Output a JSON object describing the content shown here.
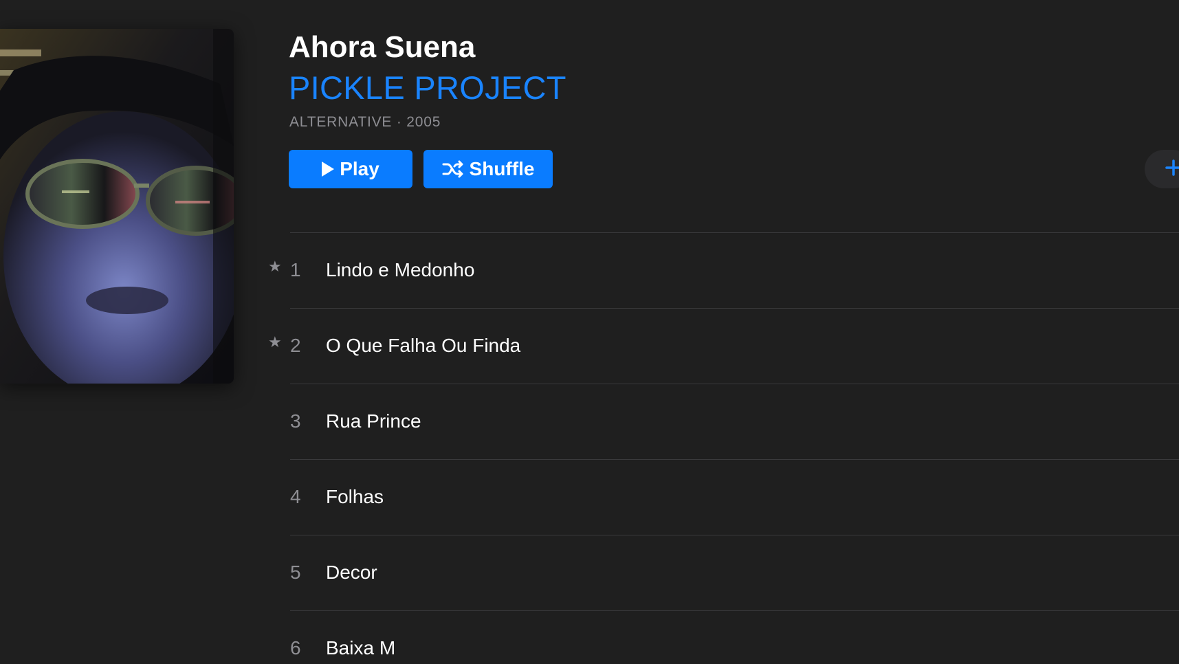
{
  "album": {
    "title": "Ahora Suena",
    "artist": "PICKLE PROJECT",
    "meta": "ALTERNATIVE · 2005"
  },
  "actions": {
    "play_label": "Play",
    "shuffle_label": "Shuffle",
    "add_icon": "plus-icon"
  },
  "tracks": [
    {
      "number": "1",
      "title": "Lindo e Medonho",
      "favorite": true
    },
    {
      "number": "2",
      "title": "O Que Falha Ou Finda",
      "favorite": true
    },
    {
      "number": "3",
      "title": "Rua Prince",
      "favorite": false
    },
    {
      "number": "4",
      "title": "Folhas",
      "favorite": false
    },
    {
      "number": "5",
      "title": "Decor",
      "favorite": false
    },
    {
      "number": "6",
      "title": "Baixa M",
      "favorite": false
    }
  ],
  "icons": {
    "star": "★"
  },
  "colors": {
    "background": "#1f1f1f",
    "accent": "#0a7cff",
    "artist_text": "#1a84ff",
    "secondary_text": "#8e8e93",
    "separator": "#3a3a3c"
  }
}
